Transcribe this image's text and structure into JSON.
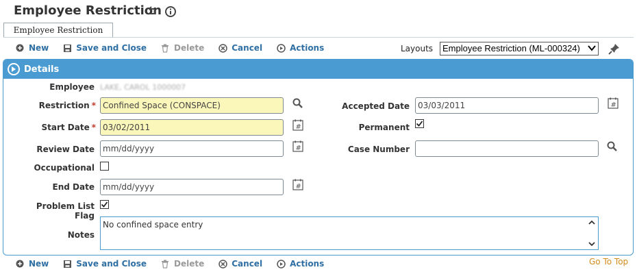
{
  "page": {
    "title": "Employee Restriction",
    "tab_label": "Employee Restriction",
    "go_to_top": "Go To Top"
  },
  "toolbar": {
    "new": "New",
    "save_close": "Save and Close",
    "delete": "Delete",
    "cancel": "Cancel",
    "actions": "Actions"
  },
  "layouts": {
    "label": "Layouts",
    "selected": "Employee Restriction (ML-000324)"
  },
  "details": {
    "header": "Details",
    "employee_label": "Employee",
    "employee_value": "LAKE, CAROL 1000007",
    "restriction_label": "Restriction",
    "restriction_value": "Confined Space (CONSPACE)",
    "start_date_label": "Start Date",
    "start_date_value": "03/02/2011",
    "review_date_label": "Review Date",
    "review_date_value": "mm/dd/yyyy",
    "occupational_label": "Occupational",
    "occupational_checked": false,
    "end_date_label": "End Date",
    "end_date_value": "mm/dd/yyyy",
    "problem_list_label": "Problem List Flag",
    "problem_list_checked": true,
    "accepted_date_label": "Accepted Date",
    "accepted_date_value": "03/03/2011",
    "permanent_label": "Permanent",
    "permanent_checked": true,
    "case_number_label": "Case Number",
    "case_number_value": "",
    "notes_label": "Notes",
    "notes_value": "No confined space entry",
    "required_mark": "*"
  },
  "colors": {
    "accent": "#4a9bd1",
    "link": "#2f6fa3",
    "required_bg": "#fbf6b9",
    "goto": "#d38b1a"
  }
}
